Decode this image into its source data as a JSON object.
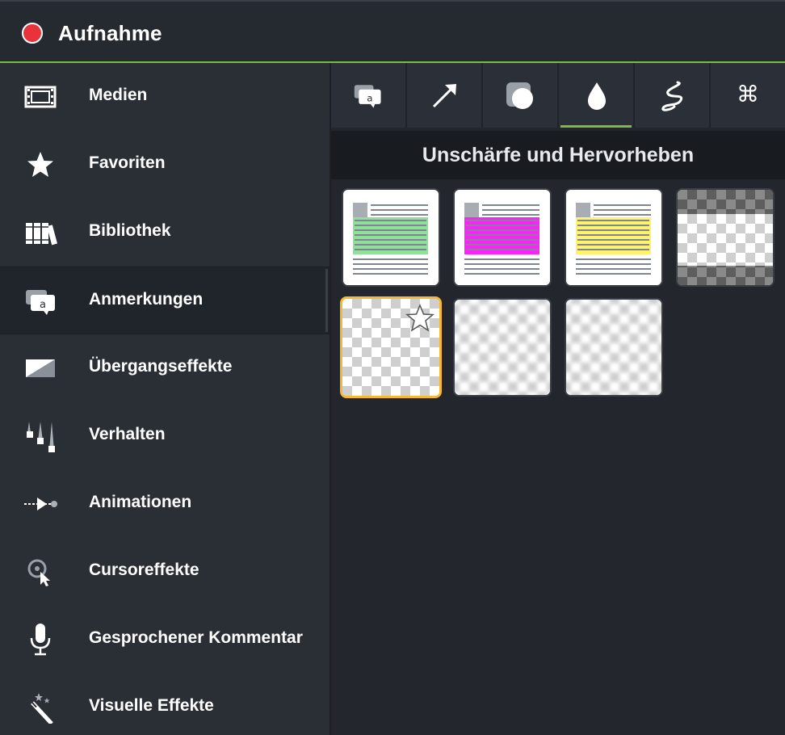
{
  "app": {
    "title": "Aufnahme",
    "record_color": "#e8333b",
    "accent": "#7dbb3c"
  },
  "sidebar": {
    "items": [
      {
        "label": "Medien",
        "icon": "film-icon",
        "active": false
      },
      {
        "label": "Favoriten",
        "icon": "star-icon",
        "active": false
      },
      {
        "label": "Bibliothek",
        "icon": "library-icon",
        "active": false
      },
      {
        "label": "Anmerkungen",
        "icon": "callout-icon",
        "active": true
      },
      {
        "label": "Übergangseffekte",
        "icon": "transition-icon",
        "active": false
      },
      {
        "label": "Verhalten",
        "icon": "behavior-icon",
        "active": false
      },
      {
        "label": "Animationen",
        "icon": "animation-icon",
        "active": false
      },
      {
        "label": "Cursoreffekte",
        "icon": "cursor-effect-icon",
        "active": false
      },
      {
        "label": "Gesprochener Kommentar",
        "icon": "microphone-icon",
        "active": false
      },
      {
        "label": "Visuelle Effekte",
        "icon": "magic-wand-icon",
        "active": false
      }
    ]
  },
  "panel": {
    "tabs": [
      {
        "icon": "callout-tab-icon",
        "active": false
      },
      {
        "icon": "arrow-tab-icon",
        "active": false
      },
      {
        "icon": "shape-tab-icon",
        "active": false
      },
      {
        "icon": "blur-drop-tab-icon",
        "active": true
      },
      {
        "icon": "sketch-motion-tab-icon",
        "active": false
      },
      {
        "icon": "command-key-tab-icon",
        "glyph": "⌘",
        "active": false
      }
    ],
    "section_title": "Unschärfe und Hervorheben",
    "thumbnails": [
      {
        "kind": "highlight",
        "color": "#8fe09a"
      },
      {
        "kind": "highlight",
        "color": "#ff1fff"
      },
      {
        "kind": "highlight",
        "color": "#fff36b"
      },
      {
        "kind": "spotlight"
      },
      {
        "kind": "blur",
        "selected": true,
        "favorite": true
      },
      {
        "kind": "blur"
      },
      {
        "kind": "blur"
      }
    ]
  }
}
